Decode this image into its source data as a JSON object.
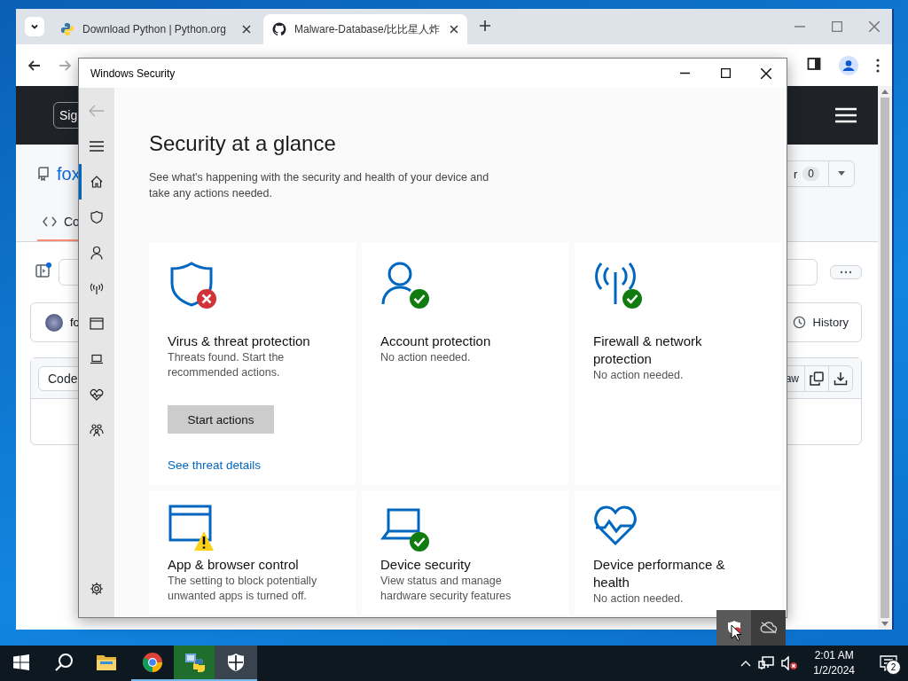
{
  "browser": {
    "tabs": [
      {
        "kind": "python",
        "title": "Download Python | Python.org",
        "selected": false
      },
      {
        "kind": "github",
        "title": "Malware-Database/比比星人炸",
        "selected": true
      }
    ],
    "page": {
      "sign_in": "Sig",
      "repo_name": "fox",
      "star_label": "r",
      "star_count": "0",
      "code_tab": {
        "label": "Co",
        "selected": true
      },
      "author": "fo",
      "history": "History",
      "code_button": "Code",
      "raw_button": "aw"
    }
  },
  "security": {
    "title": "Windows Security",
    "nav": [
      {
        "kind": "home",
        "selected": true
      },
      {
        "kind": "shield",
        "selected": false
      },
      {
        "kind": "person",
        "selected": false
      },
      {
        "kind": "antenna",
        "selected": false
      },
      {
        "kind": "window",
        "selected": false
      },
      {
        "kind": "laptop",
        "selected": false
      },
      {
        "kind": "heart",
        "selected": false
      },
      {
        "kind": "family",
        "selected": false
      },
      {
        "kind": "settings",
        "selected": false
      }
    ],
    "heading": "Security at a glance",
    "description": "See what's happening with the security and health of your device and take any actions needed.",
    "cards": [
      {
        "kind": "shield",
        "ok": false,
        "error": true,
        "warning": false,
        "title": "Virus & threat protection",
        "text": "Threats found. Start the recommended actions.",
        "button": "Start actions",
        "link": "See threat details"
      },
      {
        "kind": "person",
        "ok": true,
        "error": false,
        "warning": false,
        "title": "Account protection",
        "text": "No action needed."
      },
      {
        "kind": "antenna",
        "ok": true,
        "error": false,
        "warning": false,
        "title": "Firewall & network protection",
        "text": "No action needed."
      },
      {
        "kind": "window",
        "ok": false,
        "error": false,
        "warning": true,
        "title": "App & browser control",
        "text": "The setting to block potentially unwanted apps is turned off."
      },
      {
        "kind": "laptop",
        "ok": true,
        "error": false,
        "warning": false,
        "title": "Device security",
        "text": "View status and manage hardware security features"
      },
      {
        "kind": "heart",
        "ok": false,
        "error": false,
        "warning": false,
        "title": "Device performance & health",
        "text": "No action needed."
      }
    ]
  },
  "taskbar": {
    "apps": [
      {
        "kind": "start",
        "running": false,
        "selected": false
      },
      {
        "kind": "search",
        "running": false,
        "selected": false
      },
      {
        "kind": "folder",
        "running": false,
        "selected": false
      },
      {
        "kind": "chrome",
        "running": true,
        "selected": false
      },
      {
        "kind": "installer",
        "running": true,
        "selected": false
      },
      {
        "kind": "security",
        "running": true,
        "selected": true
      }
    ],
    "time": "2:01 AM",
    "date": "1/2/2024",
    "notifications": "2"
  }
}
